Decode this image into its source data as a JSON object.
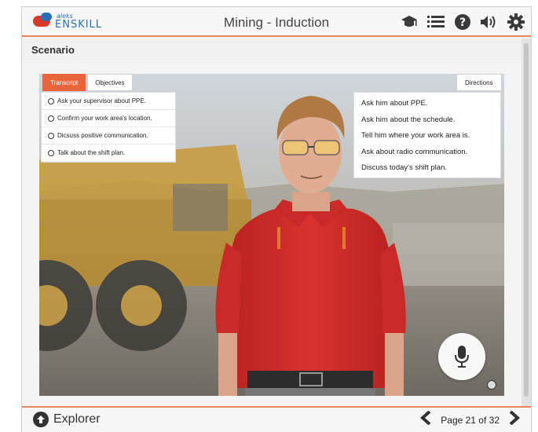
{
  "header": {
    "logo_small": "aleks",
    "logo_brand": "ENSKILL",
    "title": "Mining - Induction",
    "icons": [
      "graduation-cap-icon",
      "list-icon",
      "help-icon",
      "volume-icon",
      "gear-icon"
    ]
  },
  "section": {
    "title": "Scenario"
  },
  "tabs": {
    "transcript": "Transcript",
    "objectives": "Objectives",
    "directions": "Directions"
  },
  "objectives": [
    "Ask your supervisor about PPE.",
    "Confirm your work area's location.",
    "Dicsuss positive communication.",
    "Talk about the shift plan."
  ],
  "directions": [
    "Ask him about PPE.",
    "Ask him about the schedule.",
    "Tell him where your work area is.",
    "Ask about radio communication.",
    "Discuss today's shift plan."
  ],
  "footer": {
    "explorer_label": "Explorer",
    "page_label": "Page 21 of 32"
  },
  "colors": {
    "accent": "#e8653c",
    "divider": "#e8855a",
    "shirt": "#d8322f"
  }
}
